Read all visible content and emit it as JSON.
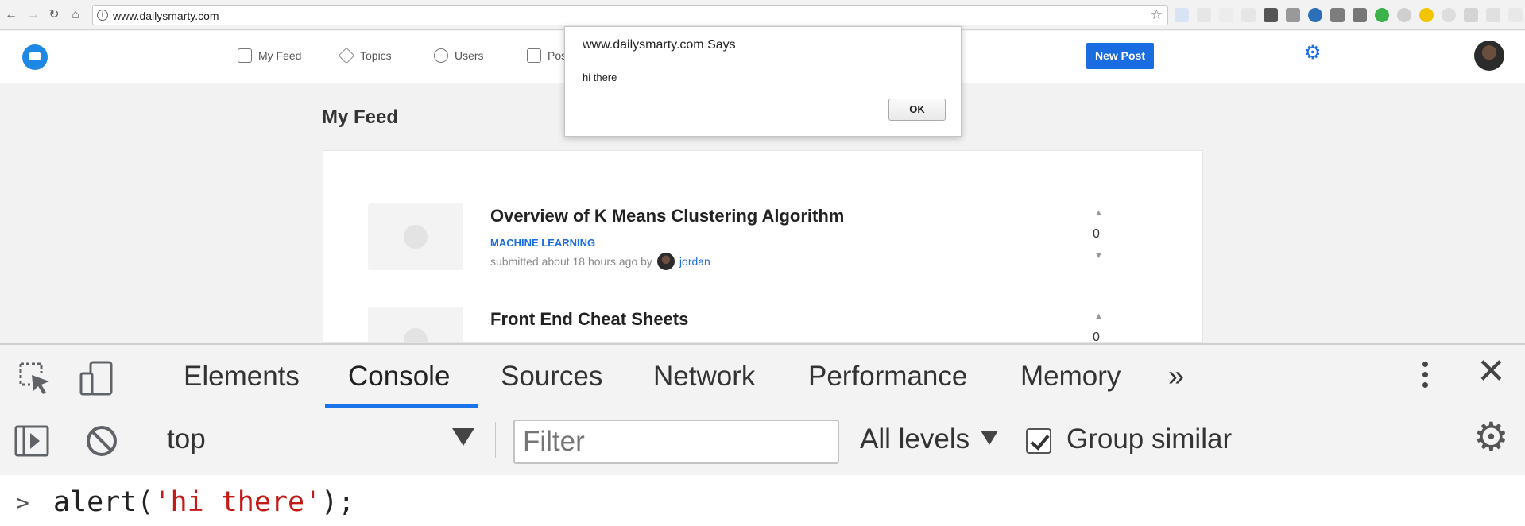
{
  "browser": {
    "url": "www.dailysmarty.com"
  },
  "header": {
    "nav": [
      {
        "label": "My Feed",
        "icon": "stack-icon"
      },
      {
        "label": "Topics",
        "icon": "layers-icon"
      },
      {
        "label": "Users",
        "icon": "users-icon"
      },
      {
        "label": "Posts",
        "icon": "document-icon"
      }
    ],
    "new_post_label": "New Post"
  },
  "main": {
    "title": "My Feed",
    "posts": [
      {
        "title": "Overview of K Means Clustering Algorithm",
        "tag": "MACHINE LEARNING",
        "meta": "submitted about 18 hours ago by",
        "author": "jordan",
        "votes": "0"
      },
      {
        "title": "Front End Cheat Sheets",
        "votes": "0"
      }
    ]
  },
  "alert": {
    "title": "www.dailysmarty.com Says",
    "message": "hi there",
    "ok_label": "OK"
  },
  "devtools": {
    "tabs": [
      "Elements",
      "Console",
      "Sources",
      "Network",
      "Performance",
      "Memory"
    ],
    "active_tab": "Console",
    "more_label": "»",
    "context": "top",
    "filter_placeholder": "Filter",
    "levels_label": "All levels",
    "group_similar_label": "Group similar",
    "group_similar_checked": true,
    "console_input": {
      "before": "alert(",
      "string": "'hi there'",
      "after": ");"
    }
  },
  "colors": {
    "accent": "#1a6de0",
    "devtools_active_tab": "#1a73e8",
    "console_string": "#c41a16"
  }
}
